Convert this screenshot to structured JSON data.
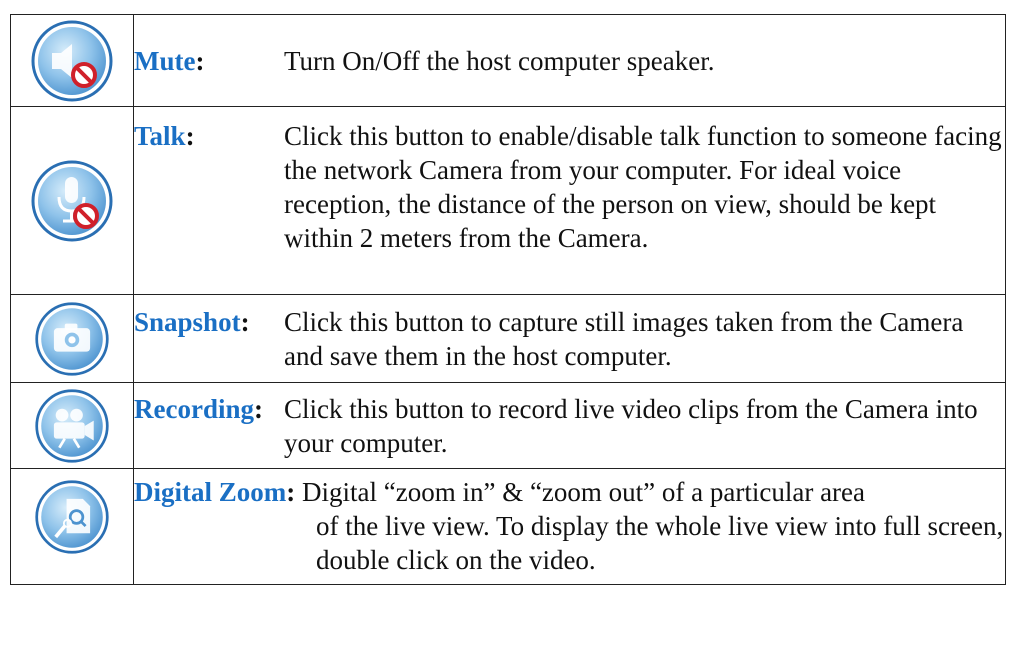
{
  "rows": [
    {
      "term": "Mute",
      "colon": ":",
      "description": "Turn On/Off the host computer speaker.",
      "icon": "speaker-muted-icon"
    },
    {
      "term": "Talk",
      "colon": ":",
      "description": "Click this button to enable/disable talk function to someone facing the network Camera from your computer. For ideal voice reception, the distance of the person on view, should be kept within 2 meters from the Camera.",
      "icon": "microphone-muted-icon"
    },
    {
      "term": "Snapshot",
      "colon": ":",
      "description": "Click this button to capture still images taken from the Camera and save them in the host computer.",
      "icon": "camera-icon"
    },
    {
      "term": "Recording",
      "colon": ":",
      "description": "Click this button to record live video clips from the Camera into your computer.",
      "icon": "video-camera-icon"
    },
    {
      "term": "Digital Zoom",
      "colon": ":",
      "description_line1": "Digital “zoom in” & “zoom out” of a particular area",
      "description_rest": "of the live view. To display the whole live view into full screen, double click on the video.",
      "icon": "zoom-document-icon"
    }
  ],
  "colors": {
    "term": "#1a6fc4",
    "icon_ring": "#2a6fb3",
    "icon_fill": "#8fc3ea",
    "prohibit": "#d0202a"
  }
}
